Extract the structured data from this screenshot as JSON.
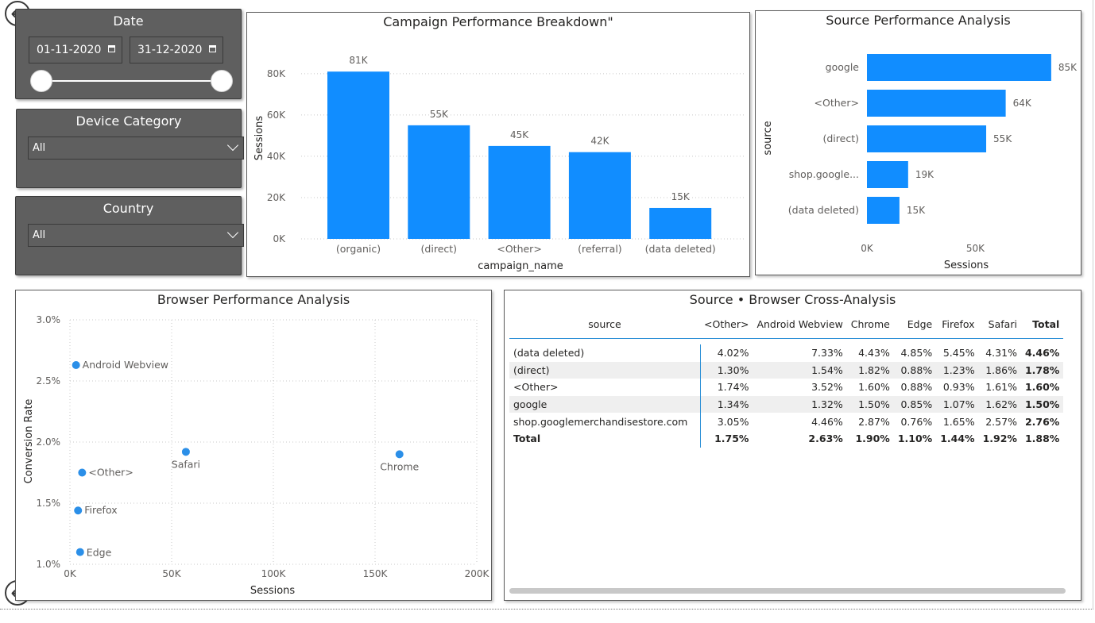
{
  "slicers": {
    "date": {
      "title": "Date",
      "start": "01-11-2020",
      "end": "31-12-2020"
    },
    "device": {
      "title": "Device Category",
      "value": "All"
    },
    "country": {
      "title": "Country",
      "value": "All"
    }
  },
  "colors": {
    "accent": "#118dff",
    "slicer_bg": "#5f5f5f"
  },
  "icons": [
    "back-arrow-icon",
    "calendar-icon",
    "chevron-down-icon"
  ],
  "chart_data": [
    {
      "type": "bar",
      "title": "Campaign Performance Breakdown\"",
      "xlabel": "campaign_name",
      "ylabel": "Sessions",
      "categories": [
        "(organic)",
        "(direct)",
        "<Other>",
        "(referral)",
        "(data deleted)"
      ],
      "values": [
        81000,
        55000,
        45000,
        42000,
        15000
      ],
      "data_labels": [
        "81K",
        "55K",
        "45K",
        "42K",
        "15K"
      ],
      "yticks": [
        "0K",
        "20K",
        "40K",
        "60K",
        "80K"
      ],
      "ylim": [
        0,
        88000
      ],
      "grid": true
    },
    {
      "type": "bar",
      "orientation": "horizontal",
      "title": "Source Performance Analysis",
      "xlabel": "Sessions",
      "ylabel": "source",
      "categories": [
        "google",
        "<Other>",
        "(direct)",
        "shop.google...",
        "(data deleted)"
      ],
      "values": [
        85000,
        64000,
        55000,
        19000,
        15000
      ],
      "data_labels": [
        "85K",
        "64K",
        "55K",
        "19K",
        "15K"
      ],
      "xticks": [
        "0K",
        "50K"
      ],
      "xlim": [
        0,
        92000
      ]
    },
    {
      "type": "scatter",
      "title": "Browser Performance Analysis",
      "xlabel": "Sessions",
      "ylabel": "Conversion Rate",
      "points": [
        {
          "label": "Android Webview",
          "x": 3000,
          "y": 2.63
        },
        {
          "label": "Safari",
          "x": 57000,
          "y": 1.92
        },
        {
          "label": "Chrome",
          "x": 162000,
          "y": 1.9
        },
        {
          "label": "<Other>",
          "x": 6000,
          "y": 1.75
        },
        {
          "label": "Firefox",
          "x": 4000,
          "y": 1.44
        },
        {
          "label": "Edge",
          "x": 5000,
          "y": 1.1
        }
      ],
      "xticks": [
        "0K",
        "50K",
        "100K",
        "150K",
        "200K"
      ],
      "yticks": [
        "1.0%",
        "1.5%",
        "2.0%",
        "2.5%",
        "3.0%"
      ],
      "xlim": [
        0,
        200000
      ],
      "ylim": [
        1.0,
        3.0
      ],
      "grid": true
    },
    {
      "type": "table",
      "title": "Source • Browser Cross-Analysis",
      "columns": [
        "source",
        "<Other>",
        "Android Webview",
        "Chrome",
        "Edge",
        "Firefox",
        "Safari",
        "Total"
      ],
      "rows": [
        [
          "(data deleted)",
          "4.02%",
          "7.33%",
          "4.43%",
          "4.85%",
          "5.45%",
          "4.31%",
          "4.46%"
        ],
        [
          "(direct)",
          "1.30%",
          "1.54%",
          "1.82%",
          "0.88%",
          "1.23%",
          "1.86%",
          "1.78%"
        ],
        [
          "<Other>",
          "1.74%",
          "3.52%",
          "1.60%",
          "0.88%",
          "0.93%",
          "1.61%",
          "1.60%"
        ],
        [
          "google",
          "1.34%",
          "1.32%",
          "1.50%",
          "0.85%",
          "1.07%",
          "1.62%",
          "1.50%"
        ],
        [
          "shop.googlemerchandisestore.com",
          "3.05%",
          "4.46%",
          "2.87%",
          "0.76%",
          "1.65%",
          "2.57%",
          "2.76%"
        ]
      ],
      "total_row": [
        "Total",
        "1.75%",
        "2.63%",
        "1.90%",
        "1.10%",
        "1.44%",
        "1.92%",
        "1.88%"
      ]
    }
  ]
}
